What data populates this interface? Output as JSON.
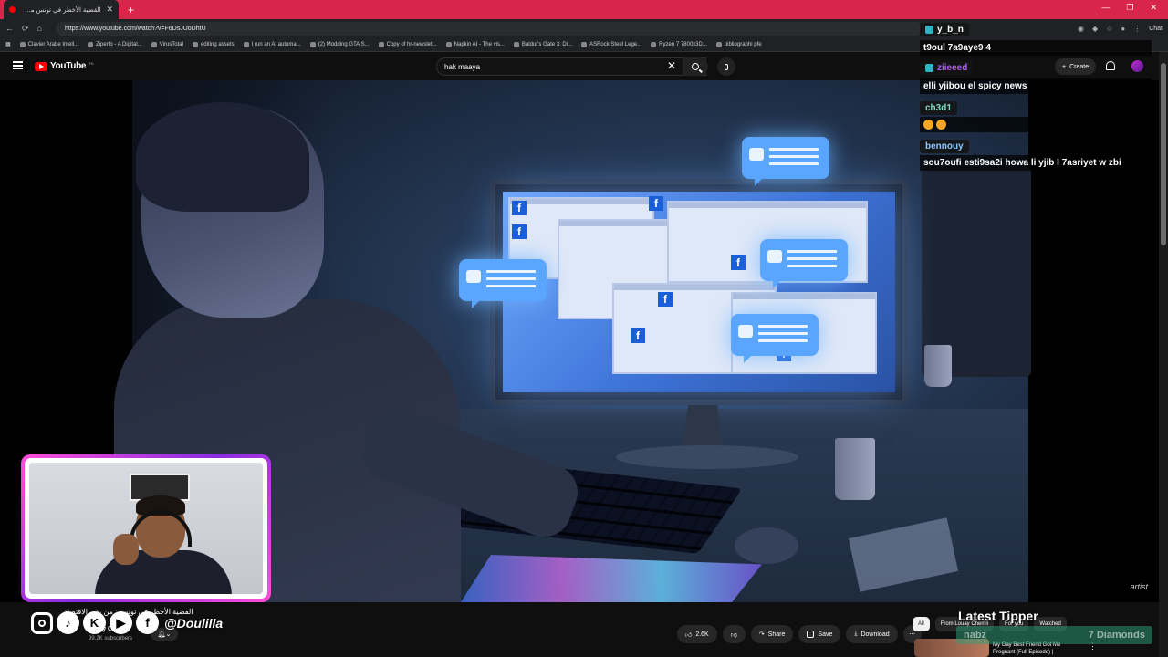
{
  "browser": {
    "tab_title": "القضية الأخطر في تونس من ر...",
    "url": "https://www.youtube.com/watch?v=F6DsJUoDhtU",
    "chat_label": "Chat",
    "bookmarks": [
      "Clavier Arabe Intell...",
      "Ziperto - A Digital...",
      "VirusTotal",
      "editing assets",
      "I run an AI automa...",
      "(2) Modding GTA S...",
      "Copy of hr-newslet...",
      "Napkin AI - The vis...",
      "Baldur's Gate 3: Di...",
      "ASRock Steel Lege...",
      "Ryzen 7 7800x3D...",
      "bibliographi pfe"
    ]
  },
  "youtube": {
    "logo_text": "YouTube",
    "logo_sup": "TN",
    "search_value": "hak maaya",
    "create_label": "Create",
    "video_title": "القضية الأخطر في تونس : من يدير الاقتصاد",
    "channel_name": "Louay Chemli",
    "subscribers": "99.2K subscribers",
    "likes": "2.6K",
    "share_label": "Share",
    "save_label": "Save",
    "download_label": "Download",
    "chips": [
      "All",
      "From Louay Chemli",
      "For you",
      "Watched"
    ],
    "rec_title": "My Gay Best Friend Got Me Pregnant (Full Episode) |"
  },
  "chat": [
    {
      "name": "y_b_n",
      "color": "#ffffff",
      "message": "t9oul 7a9aye9 4"
    },
    {
      "name": "ziieeed",
      "color": "#b15cff",
      "message": "elli yjibou el spicy news"
    },
    {
      "name": "ch3d1",
      "color": "#7fd8b8",
      "message": ""
    },
    {
      "name": "bennouy",
      "color": "#8cc8ff",
      "message": "sou7oufi esti9sa2i howa li yjib l 7asriyet w zbi"
    }
  ],
  "overlay": {
    "handle": "@Doulilla",
    "latest_tipper_label": "Latest Tipper",
    "tipper_name": "nabz",
    "tipper_amount": "7 Diamonds",
    "watermark": "artist"
  },
  "colors": {
    "tabbar": "#d7264a",
    "youtube_red": "#ff0000",
    "webcam_border": "#ff4fd8"
  }
}
